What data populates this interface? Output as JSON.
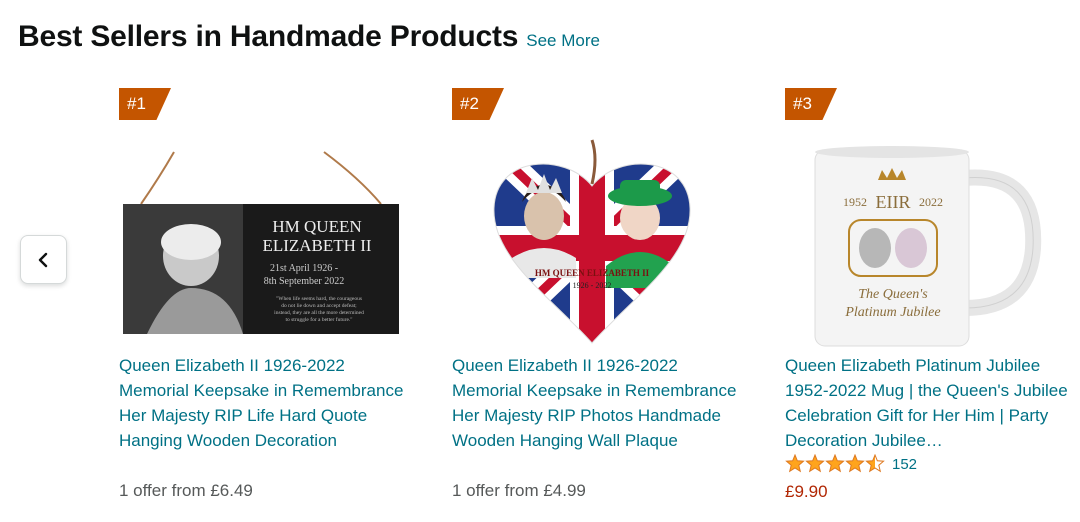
{
  "header": {
    "title": "Best Sellers in Handmade Products",
    "see_more": "See More"
  },
  "carousel": {
    "prev_icon": "chevron-left-icon"
  },
  "products": [
    {
      "rank": "#1",
      "title": "Queen Elizabeth II 1926-2022 Memorial Keepsake in Remembrance Her Majesty RIP Life Hard Quote Hanging Wooden Decoration",
      "offer": "1 offer from £6.49",
      "image_text": {
        "line1": "HM QUEEN",
        "line2": "ELIZABETH II",
        "date1": "21st April 1926 -",
        "date2": "8th September 2022",
        "quote1": "\"When life seems hard, the courageous",
        "quote2": "do not lie down and accept defeat;",
        "quote3": "instead, they are all the more determined",
        "quote4": "to struggle for a better future.\""
      }
    },
    {
      "rank": "#2",
      "title": "Queen Elizabeth II 1926-2022 Memorial Keepsake in Remembrance Her Majesty RIP Photos Handmade Wooden Hanging Wall Plaque",
      "offer": "1 offer from £4.99",
      "image_text": {
        "line1": "HM QUEEN ELIZABETH II",
        "line2": "1926 - 2022"
      }
    },
    {
      "rank": "#3",
      "title": "Queen Elizabeth Platinum Jubilee 1952-2022 Mug | the Queen's Jubilee Celebration Gift for Her Him | Party Decoration Jubilee…",
      "rating": 4.5,
      "rating_count": "152",
      "price": "£9.90",
      "image_text": {
        "years_left": "1952",
        "cypher": "EIIR",
        "years_right": "2022",
        "script1": "The Queen's",
        "script2": "Platinum Jubilee"
      }
    }
  ],
  "colors": {
    "rank_badge": "#c45500",
    "link": "#007185",
    "price": "#b12704",
    "star": "#ffa41c"
  }
}
